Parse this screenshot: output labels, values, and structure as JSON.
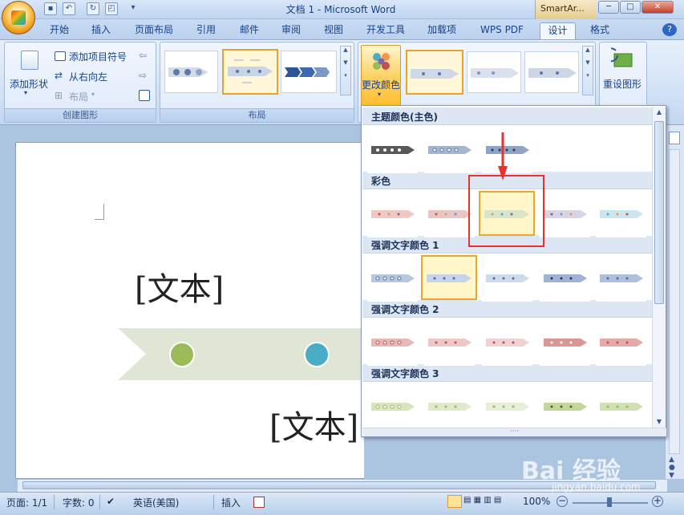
{
  "window": {
    "title": "文档 1 - Microsoft Word",
    "context_tab": "SmartAr...",
    "min": "─",
    "max": "□",
    "close": "✕"
  },
  "quick_access": [
    "save-icon",
    "undo-icon",
    "redo-icon",
    "print-preview-icon",
    "customize-icon"
  ],
  "tabs": [
    "开始",
    "插入",
    "页面布局",
    "引用",
    "邮件",
    "审阅",
    "视图",
    "开发工具",
    "加载项",
    "WPS PDF",
    "设计",
    "格式"
  ],
  "active_tab": "设计",
  "ribbon": {
    "create_group": {
      "title": "创建图形",
      "add_shape": "添加形状",
      "add_bullet": "添加项目符号",
      "right_to_left": "从右向左",
      "layout": "布局"
    },
    "layout_group": {
      "title": "布局"
    },
    "styles": {
      "change_colors": "更改颜色",
      "reset": "重设图形"
    }
  },
  "document": {
    "text_top": "[文本]",
    "text_bottom": "[文本]",
    "colors": {
      "arrow": "#dfe7d4",
      "circle1": "#9bbb59",
      "circle2": "#4bacc6"
    }
  },
  "dropdown": {
    "sections": [
      {
        "title": "主题颜色(主色)"
      },
      {
        "title": "彩色"
      },
      {
        "title": "强调文字颜色 1"
      },
      {
        "title": "强调文字颜色 2"
      },
      {
        "title": "强调文字颜色 3"
      }
    ],
    "grip": "····"
  },
  "status_bar": {
    "page": "页面: 1/1",
    "words": "字数: 0",
    "language": "英语(美国)",
    "mode": "插入",
    "zoom": "100%"
  },
  "watermark": {
    "text": "Bai 经验",
    "sub": "jingyan.baidu.com"
  },
  "highlight_color": "#e8312f"
}
